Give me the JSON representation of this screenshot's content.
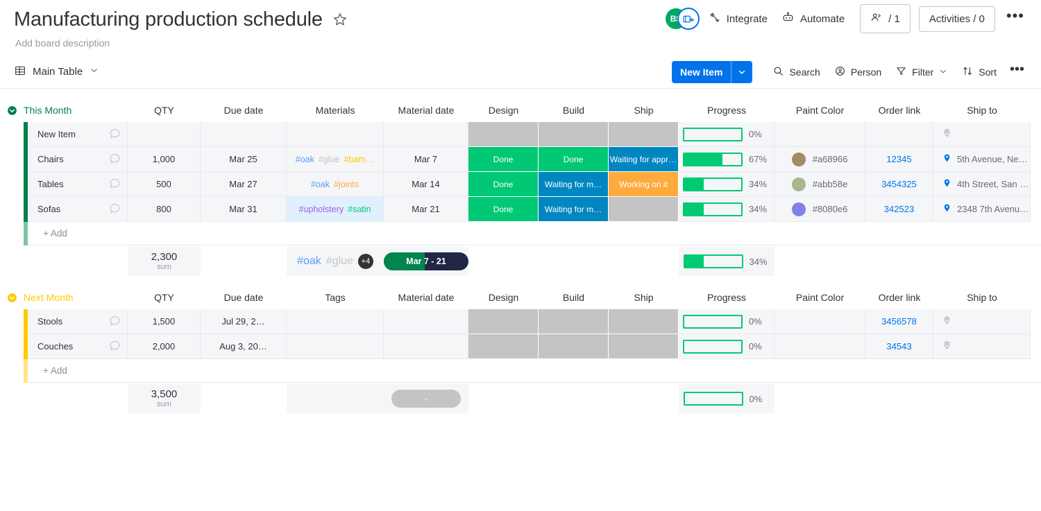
{
  "header": {
    "title": "Manufacturing production schedule",
    "description": "Add board description",
    "star_icon": "star-icon",
    "avatar_initials": "BS",
    "avatar_color": "#00a862",
    "integrate_label": "Integrate",
    "automate_label": "Automate",
    "people_label": "/ 1",
    "activities_label": "Activities / 0",
    "more_label": "•••"
  },
  "toolbar": {
    "view_label": "Main Table",
    "new_item_label": "New Item",
    "search_label": "Search",
    "person_label": "Person",
    "filter_label": "Filter",
    "sort_label": "Sort",
    "more_label": "•••"
  },
  "colors": {
    "accent_blue": "#0073ea",
    "green": "#00ca72",
    "dark_green": "#00854d",
    "orange": "#fdab3d",
    "status_blue": "#0086c0",
    "grey": "#c4c4c4",
    "yellow": "#ffcb00"
  },
  "groups": [
    {
      "name": "This Month",
      "color": "#037f4c",
      "light_color": "#7ec4a3",
      "columns": [
        "QTY",
        "Due date",
        "Materials",
        "Material date",
        "Design",
        "Build",
        "Ship",
        "Progress",
        "Paint Color",
        "Order link",
        "Ship to"
      ],
      "add_label": "+ Add",
      "rows": [
        {
          "name": "New Item",
          "qty": "",
          "due": "",
          "materials": [],
          "material_date": "",
          "design": {
            "label": "",
            "color": "#c4c4c4"
          },
          "build": {
            "label": "",
            "color": "#c4c4c4"
          },
          "ship": {
            "label": "",
            "color": "#c4c4c4"
          },
          "progress": 0,
          "progress_label": "0%",
          "paint": "",
          "paint_color": "",
          "link": "",
          "ship_to": "",
          "ship_to_filled": false,
          "materials_selected": false
        },
        {
          "name": "Chairs",
          "qty": "1,000",
          "due": "Mar 25",
          "materials": [
            {
              "text": "#oak",
              "color": "#579bfc"
            },
            {
              "text": "#glue",
              "color": "#c4c4c4"
            },
            {
              "text": "#bam…",
              "color": "#ffcb00"
            }
          ],
          "material_date": "Mar 7",
          "design": {
            "label": "Done",
            "color": "#00c875"
          },
          "build": {
            "label": "Done",
            "color": "#00c875"
          },
          "ship": {
            "label": "Waiting for appr…",
            "color": "#0086c0"
          },
          "progress": 67,
          "progress_label": "67%",
          "paint": "#a68966",
          "paint_color": "#a68966",
          "link": "12345",
          "ship_to": "5th Avenue, Ne…",
          "ship_to_filled": true,
          "materials_selected": false
        },
        {
          "name": "Tables",
          "qty": "500",
          "due": "Mar 27",
          "materials": [
            {
              "text": "#oak",
              "color": "#579bfc"
            },
            {
              "text": "#joints",
              "color": "#fdab3d"
            }
          ],
          "material_date": "Mar 14",
          "design": {
            "label": "Done",
            "color": "#00c875"
          },
          "build": {
            "label": "Waiting for m…",
            "color": "#0086c0"
          },
          "ship": {
            "label": "Working on it",
            "color": "#fdab3d"
          },
          "progress": 34,
          "progress_label": "34%",
          "paint": "#abb58e",
          "paint_color": "#abb58e",
          "link": "3454325",
          "ship_to": "4th Street, San …",
          "ship_to_filled": true,
          "materials_selected": false
        },
        {
          "name": "Sofas",
          "qty": "800",
          "due": "Mar 31",
          "materials": [
            {
              "text": "#upholstery",
              "color": "#a25ddc"
            },
            {
              "text": "#satin",
              "color": "#00c875"
            }
          ],
          "material_date": "Mar 21",
          "design": {
            "label": "Done",
            "color": "#00c875"
          },
          "build": {
            "label": "Waiting for m…",
            "color": "#0086c0"
          },
          "ship": {
            "label": "",
            "color": "#c4c4c4"
          },
          "progress": 34,
          "progress_label": "34%",
          "paint": "#8080e6",
          "paint_color": "#8080e6",
          "link": "342523",
          "ship_to": "2348 7th Avenu…",
          "ship_to_filled": true,
          "materials_selected": true
        }
      ],
      "summary": {
        "qty_value": "2,300",
        "qty_label": "sum",
        "materials": [
          {
            "text": "#oak",
            "color": "#579bfc"
          },
          {
            "text": "#glue",
            "color": "#c4c4c4"
          }
        ],
        "materials_extra": "+4",
        "date_pill": "Mar 7 - 21",
        "date_pill_fill_pct": 48,
        "progress": 34,
        "progress_label": "34%"
      }
    },
    {
      "name": "Next Month",
      "color": "#ffcb00",
      "light_color": "#ffe680",
      "columns": [
        "QTY",
        "Due date",
        "Tags",
        "Material date",
        "Design",
        "Build",
        "Ship",
        "Progress",
        "Paint Color",
        "Order link",
        "Ship to"
      ],
      "add_label": "+ Add",
      "rows": [
        {
          "name": "Stools",
          "qty": "1,500",
          "due": "Jul 29, 2…",
          "materials": [],
          "material_date": "",
          "design": {
            "label": "",
            "color": "#c4c4c4"
          },
          "build": {
            "label": "",
            "color": "#c4c4c4"
          },
          "ship": {
            "label": "",
            "color": "#c4c4c4"
          },
          "progress": 0,
          "progress_label": "0%",
          "paint": "",
          "paint_color": "",
          "link": "3456578",
          "ship_to": "",
          "ship_to_filled": false,
          "materials_selected": false
        },
        {
          "name": "Couches",
          "qty": "2,000",
          "due": "Aug 3, 20…",
          "materials": [],
          "material_date": "",
          "design": {
            "label": "",
            "color": "#c4c4c4"
          },
          "build": {
            "label": "",
            "color": "#c4c4c4"
          },
          "ship": {
            "label": "",
            "color": "#c4c4c4"
          },
          "progress": 0,
          "progress_label": "0%",
          "paint": "",
          "paint_color": "",
          "link": "34543",
          "ship_to": "",
          "ship_to_filled": false,
          "materials_selected": false
        }
      ],
      "summary": {
        "qty_value": "3,500",
        "qty_label": "sum",
        "materials": [],
        "materials_extra": "",
        "date_pill": "-",
        "date_pill_fill_pct": 0,
        "date_pill_empty": true,
        "progress": 0,
        "progress_label": "0%"
      }
    }
  ]
}
